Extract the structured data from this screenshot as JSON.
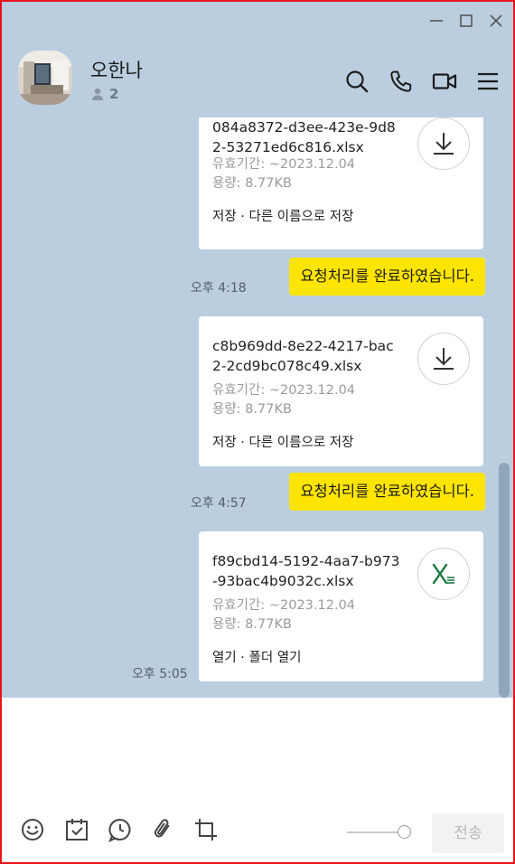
{
  "header": {
    "title": "오한나",
    "member_count": "2"
  },
  "icons": {
    "minimize": "minimize-icon",
    "maximize": "maximize-icon",
    "close": "close-icon",
    "search": "search-icon",
    "call": "phone-icon",
    "video": "video-camera-icon",
    "menu": "hamburger-menu-icon",
    "person": "person-icon",
    "download": "download-icon",
    "excel": "excel-icon",
    "emoticon": "emoticon-icon",
    "schedule": "calendar-check-icon",
    "reservation": "clock-message-icon",
    "attach": "paperclip-icon",
    "capture": "crop-icon"
  },
  "messages": [
    {
      "type": "file",
      "file_name": "084a8372-d3ee-423e-9d82-53271ed6c816.xlsx",
      "expiry": "유효기간: ~2023.12.04",
      "size": "용량: 8.77KB",
      "actions": "저장 · 다른 이름으로 저장",
      "button": "download"
    },
    {
      "type": "text",
      "time": "오후 4:18",
      "text": "요청처리를 완료하였습니다."
    },
    {
      "type": "file",
      "file_name": "c8b969dd-8e22-4217-bac2-2cd9bc078c49.xlsx",
      "expiry": "유효기간: ~2023.12.04",
      "size": "용량: 8.77KB",
      "actions": "저장 · 다른 이름으로 저장",
      "button": "download"
    },
    {
      "type": "text",
      "time": "오후 4:57",
      "text": "요청처리를 완료하였습니다."
    },
    {
      "type": "file",
      "time": "오후 5:05",
      "file_name": "f89cbd14-5192-4aa7-b973-93bac4b9032c.xlsx",
      "expiry": "유효기간: ~2023.12.04",
      "size": "용량: 8.77KB",
      "actions": "열기 · 폴더 열기",
      "button": "excel"
    }
  ],
  "input": {
    "send_label": "전송"
  },
  "colors": {
    "chat_background": "#bacee0",
    "my_bubble": "#fee500",
    "window_border": "#e8141b",
    "excel_green": "#1e7b45"
  }
}
